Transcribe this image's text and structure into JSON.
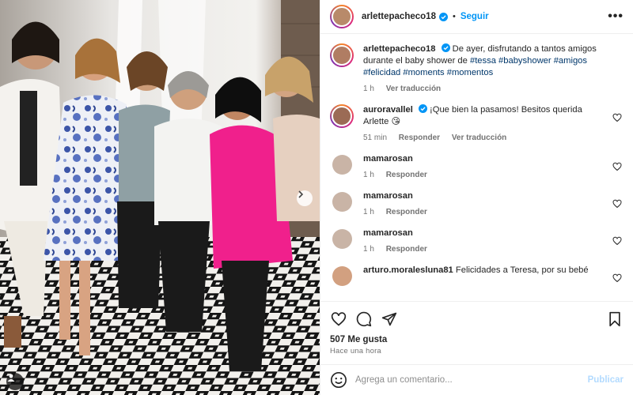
{
  "header": {
    "username": "arlettepacheco18",
    "separator": "•",
    "follow_label": "Seguir",
    "more_label": "•••"
  },
  "caption": {
    "username": "arlettepacheco18",
    "text": "De ayer, disfrutando a tantos amigos durante el baby shower de",
    "hashtags": [
      "#tessa",
      "#babyshower",
      "#amigos",
      "#felicidad",
      "#moments",
      "#momentos"
    ],
    "time": "1 h",
    "translate": "Ver traducción"
  },
  "comments": [
    {
      "username": "auroravallel",
      "verified": true,
      "text": "¡Que bien la pasamos! Besitos querida Arlette 😘",
      "time": "51 min",
      "reply": "Responder",
      "translate": "Ver traducción"
    },
    {
      "username": "mamarosan",
      "verified": false,
      "text": "",
      "time": "1 h",
      "reply": "Responder"
    },
    {
      "username": "mamarosan",
      "verified": false,
      "text": "",
      "time": "1 h",
      "reply": "Responder"
    },
    {
      "username": "mamarosan",
      "verified": false,
      "text": "",
      "time": "1 h",
      "reply": "Responder"
    },
    {
      "username": "arturo.moralesluna81",
      "verified": false,
      "text": "Felicidades a Teresa, por su bebé",
      "time": "",
      "reply": ""
    }
  ],
  "actions": {
    "icons": [
      "heart-icon",
      "comment-icon",
      "share-icon",
      "bookmark-icon"
    ],
    "likes": "507 Me gusta",
    "posted": "Hace una hora"
  },
  "add_comment": {
    "placeholder": "Agrega un comentario...",
    "post_label": "Publicar"
  },
  "colors": {
    "accent": "#0095f6",
    "link": "#00376b",
    "muted": "#737373",
    "post_disabled": "#b3dbff",
    "pink_dress": "#f0208c"
  }
}
